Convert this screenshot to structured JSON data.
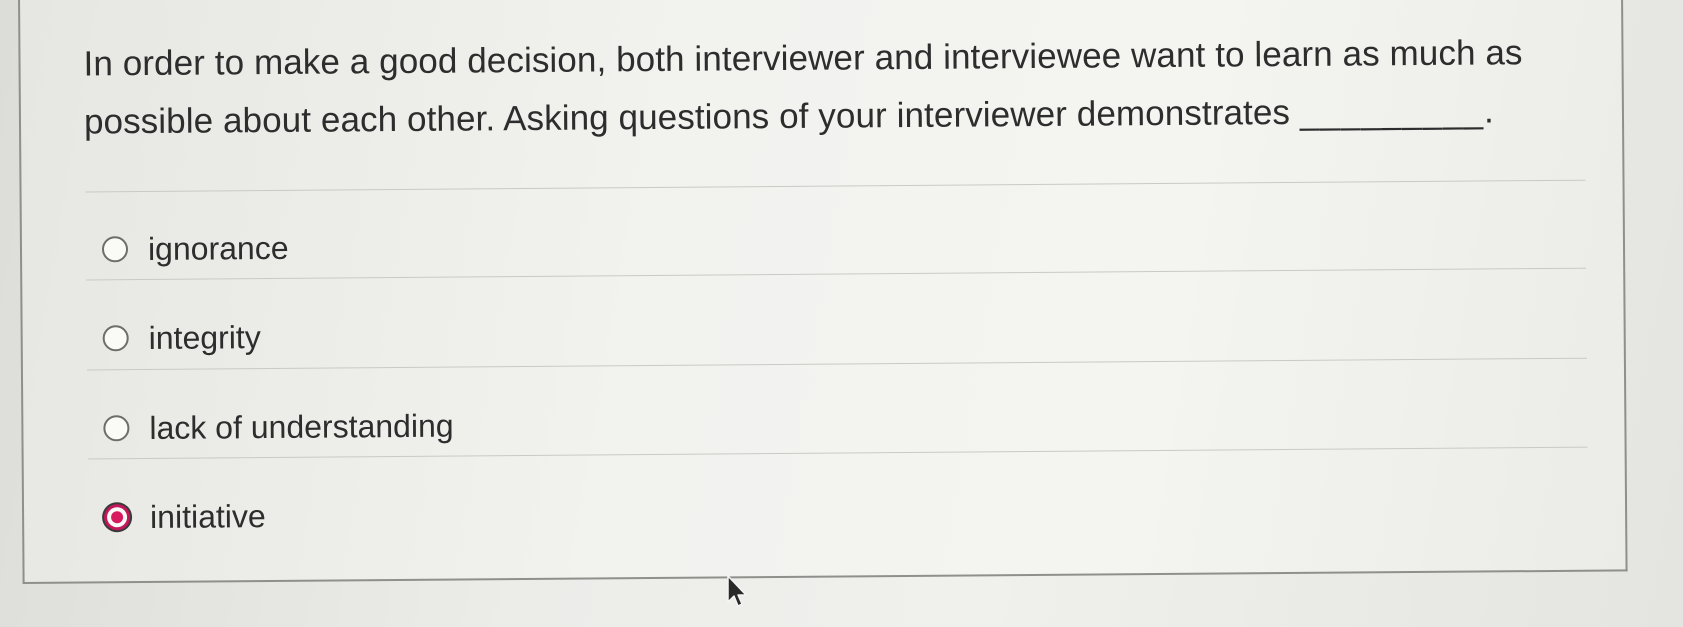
{
  "question": {
    "text": "In order to make a good decision, both interviewer and interviewee want to learn as much as possible about each other. Asking questions of your interviewer demonstrates",
    "blank": "_________."
  },
  "options": [
    {
      "label": "ignorance",
      "selected": false
    },
    {
      "label": "integrity",
      "selected": false
    },
    {
      "label": "lack of understanding",
      "selected": false
    },
    {
      "label": "initiative",
      "selected": true
    }
  ],
  "colors": {
    "selected_accent": "#d81b60",
    "text": "#2d2d2d"
  },
  "icons": {
    "cursor": "mouse-pointer-icon"
  }
}
